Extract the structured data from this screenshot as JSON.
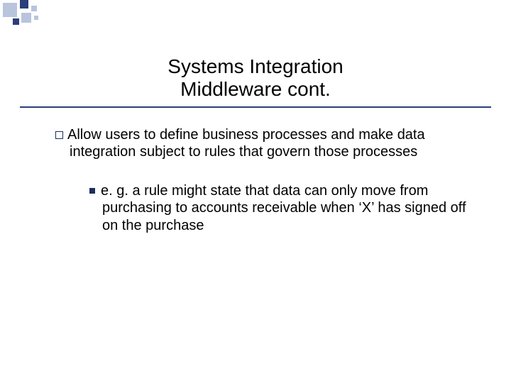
{
  "title": {
    "line1": "Systems Integration",
    "line2": "Middleware cont."
  },
  "bullets": {
    "level1_0": "Allow users to define business processes and make data integration subject to rules that govern those processes",
    "level2_0": "e. g. a rule might state that data can only move from purchasing to accounts receivable when ‘X’ has signed off on the purchase"
  }
}
